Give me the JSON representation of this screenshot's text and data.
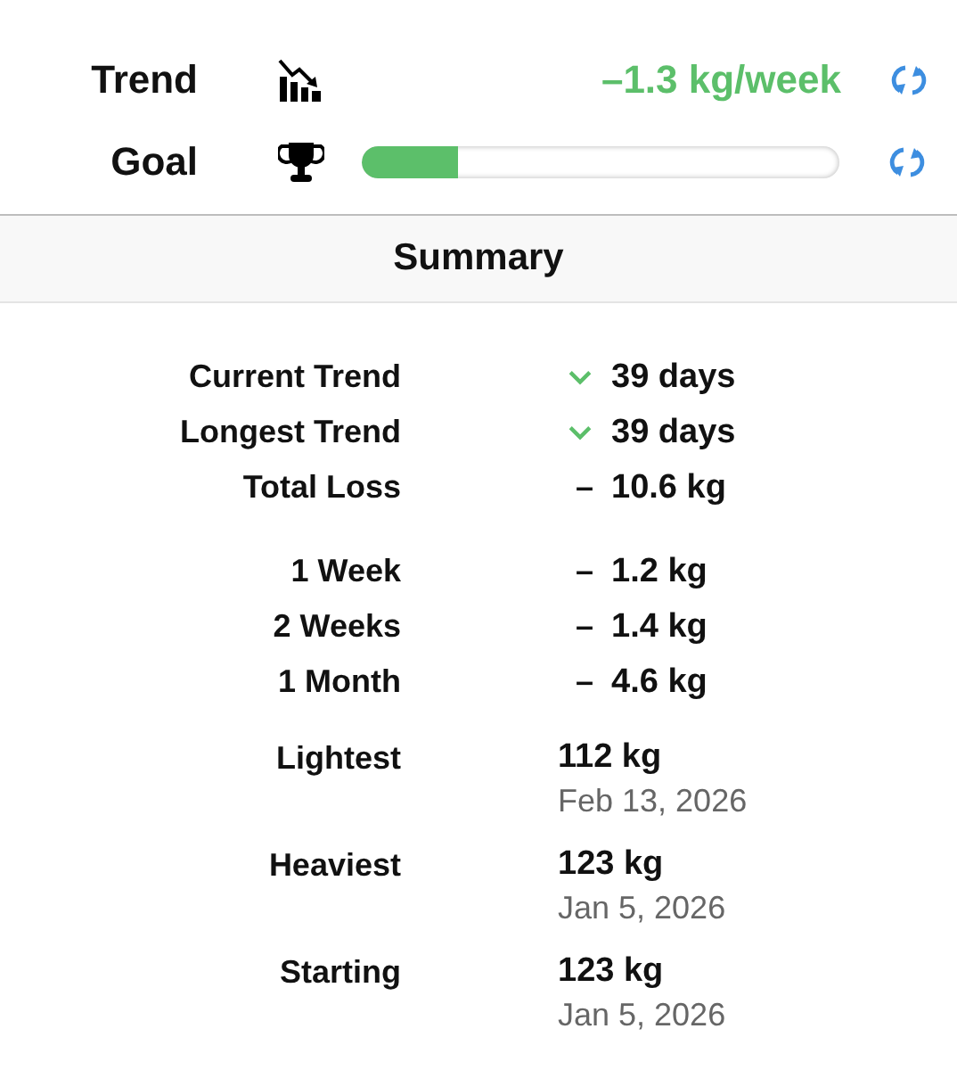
{
  "header": {
    "trend": {
      "label": "Trend",
      "value": "–1.3 kg/week"
    },
    "goal": {
      "label": "Goal",
      "level": 0.2
    }
  },
  "summary": {
    "title": "Summary",
    "groups": [
      {
        "rows": [
          {
            "label": "Current Trend",
            "indicator": {
              "kind": "chevron"
            },
            "value": "39 days"
          },
          {
            "label": "Longest Trend",
            "indicator": {
              "kind": "chevron"
            },
            "value": "39 days"
          },
          {
            "label": "Total Loss",
            "indicator": {
              "kind": "dash",
              "text": "–"
            },
            "value": "10.6 kg"
          }
        ]
      },
      {
        "rows": [
          {
            "label": "1 Week",
            "indicator": {
              "kind": "dash",
              "text": "–"
            },
            "value": "1.2 kg"
          },
          {
            "label": "2 Weeks",
            "indicator": {
              "kind": "dash",
              "text": "–"
            },
            "value": "1.4 kg"
          },
          {
            "label": "1 Month",
            "indicator": {
              "kind": "dash",
              "text": "–"
            },
            "value": "4.6 kg"
          }
        ]
      }
    ],
    "records": [
      {
        "label": "Lightest",
        "value": "112 kg",
        "date": "Feb 13, 2026"
      },
      {
        "label": "Heaviest",
        "value": "123 kg",
        "date": "Jan 5, 2026"
      },
      {
        "label": "Starting",
        "value": "123 kg",
        "date": "Jan 5, 2026"
      }
    ]
  }
}
